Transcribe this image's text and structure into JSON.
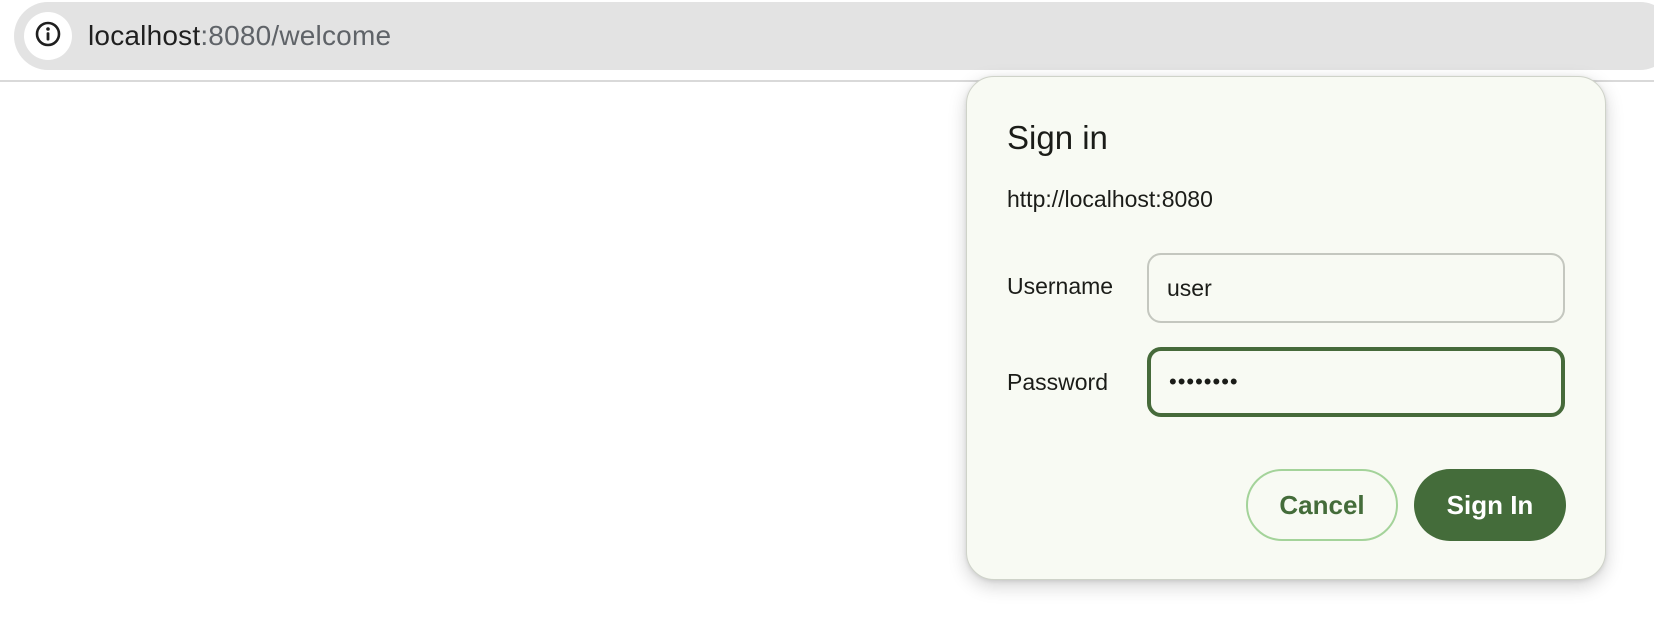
{
  "browser": {
    "address_bar": {
      "host": "localhost",
      "rest": ":8080/welcome",
      "site_info_icon": "info-circle-icon"
    }
  },
  "dialog": {
    "title": "Sign in",
    "origin": "http://localhost:8080",
    "username": {
      "label": "Username",
      "value": "user"
    },
    "password": {
      "label": "Password",
      "masked_value": "••••••••"
    },
    "buttons": {
      "cancel": "Cancel",
      "sign_in": "Sign In"
    }
  },
  "colors": {
    "accent": "#446c3a",
    "cancel_border": "#a4d39a",
    "dialog_background": "#f8faf3",
    "address_bar_background": "#e3e3e3"
  }
}
